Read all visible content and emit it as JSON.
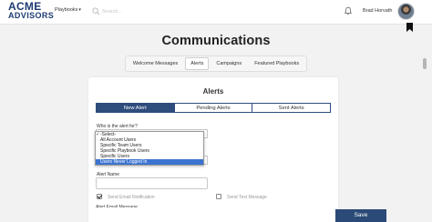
{
  "header": {
    "logo_line1": "ACME",
    "logo_line2": "ADVISORS",
    "playbooks_label": "Playbooks",
    "search_placeholder": "Search...",
    "user_name": "Brad Horvath"
  },
  "page": {
    "title": "Communications",
    "tabs": [
      {
        "label": "Welcome Messages",
        "active": false
      },
      {
        "label": "Alerts",
        "active": true
      },
      {
        "label": "Campaigns",
        "active": false
      },
      {
        "label": "Featured Playbooks",
        "active": false
      }
    ]
  },
  "card": {
    "title": "Alerts",
    "subtabs": [
      {
        "label": "New Alert",
        "active": true
      },
      {
        "label": "Pending Alerts",
        "active": false
      },
      {
        "label": "Sent Alerts",
        "active": false
      }
    ],
    "who_label": "Who is the alert for?",
    "dropdown_options": [
      {
        "label": "-Select-",
        "checked": true,
        "highlighted": false
      },
      {
        "label": "All Account Users",
        "checked": false,
        "highlighted": false
      },
      {
        "label": "Specific Team Users",
        "checked": false,
        "highlighted": false
      },
      {
        "label": "Specific Playbook Users",
        "checked": false,
        "highlighted": false
      },
      {
        "label": "Specific Users",
        "checked": false,
        "highlighted": false
      },
      {
        "label": "Users Never Logged In",
        "checked": false,
        "highlighted": true
      }
    ],
    "alert_name_label": "Alert Name",
    "alert_name_value": "",
    "send_email_label": "Send Email Notification",
    "send_email_checked": true,
    "send_text_label": "Send Text Message",
    "send_text_checked": false,
    "alert_email_label": "Alert Email Message"
  },
  "footer": {
    "save_label": "Save"
  },
  "colors": {
    "brand_navy": "#1d3b72",
    "active_tab": "#2e4d7d",
    "save_button": "#2b4a77",
    "dropdown_highlight": "#3b74d0"
  },
  "icons": [
    "search-icon",
    "bell-icon",
    "avatar",
    "bookmark-icon",
    "chevron-down-icon",
    "check-icon"
  ]
}
